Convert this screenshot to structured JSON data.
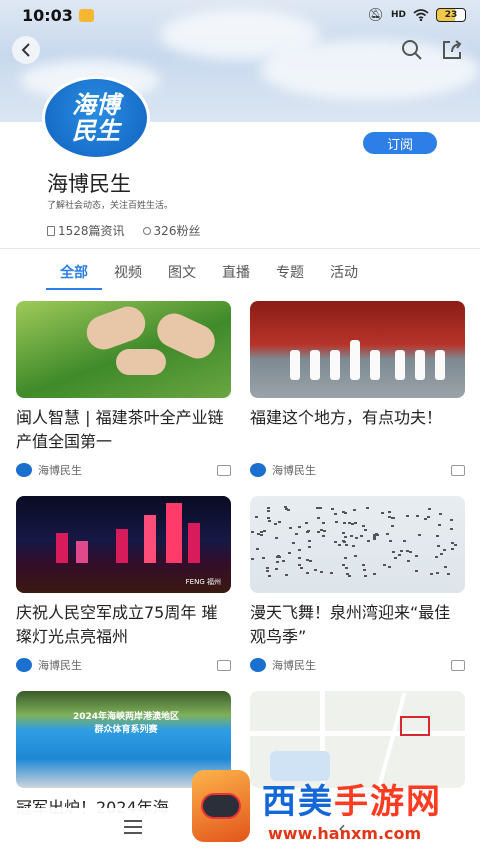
{
  "status_bar": {
    "time": "10:03",
    "network": "HD",
    "battery": "23"
  },
  "header": {
    "back_icon": "back-icon",
    "search_icon": "search-icon",
    "share_icon": "share-icon"
  },
  "channel": {
    "avatar_text_line1": "海博",
    "avatar_text_line2": "民生",
    "name": "海博民生",
    "description": "了解社会动态，关注百姓生活。",
    "articles": "1528篇资讯",
    "followers": "326粉丝",
    "subscribe_label": "订阅"
  },
  "tabs": [
    {
      "label": "全部",
      "active": true
    },
    {
      "label": "视频",
      "active": false
    },
    {
      "label": "图文",
      "active": false
    },
    {
      "label": "直播",
      "active": false
    },
    {
      "label": "专题",
      "active": false
    },
    {
      "label": "活动",
      "active": false
    }
  ],
  "articles": [
    {
      "title": "闽人智慧 | 福建茶叶全产业链产值全国第一",
      "source": "海博民生"
    },
    {
      "title": "福建这个地方，有点功夫！",
      "source": "海博民生"
    },
    {
      "title": "庆祝人民空军成立75周年 璀璨灯光点亮福州",
      "source": "海博民生"
    },
    {
      "title": "漫天飞舞！泉州湾迎来“最佳观鸟季”",
      "source": "海博民生"
    },
    {
      "title": "冠军出炉！2024年海",
      "source": ""
    },
    {
      "title": "",
      "source": ""
    }
  ],
  "thumb_texts": {
    "night_caption": "FENG 福州",
    "sport_banner": "2024年海峡两岸港澳地区",
    "sport_banner2": "群众体育系列赛"
  },
  "watermark": {
    "title_a": "西美",
    "title_b": "手游网",
    "url": "www.hanxm.com"
  },
  "colors": {
    "accent": "#2d7ee6",
    "brand_blue": "#1062c1"
  }
}
